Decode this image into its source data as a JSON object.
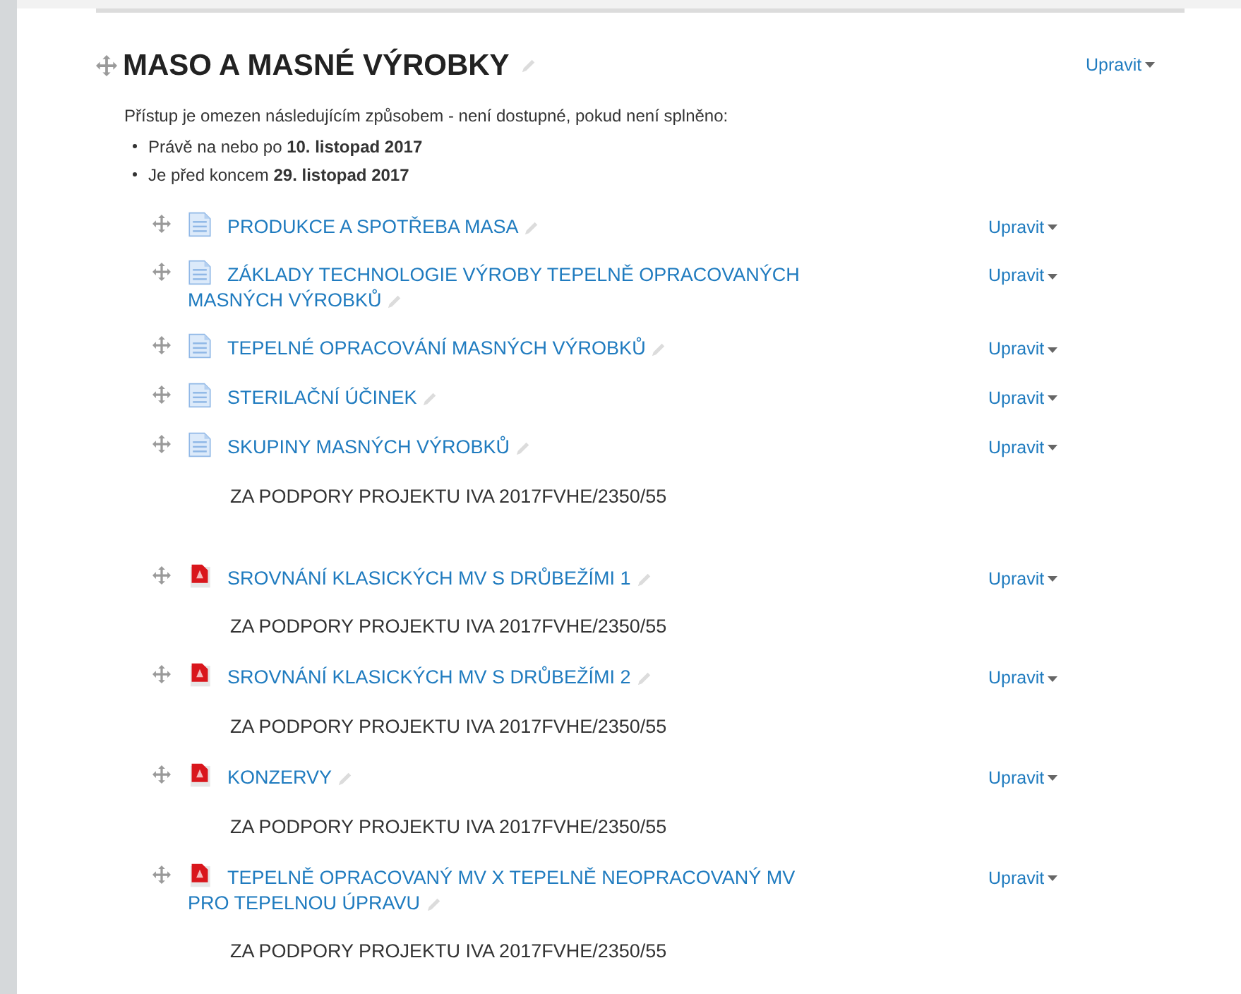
{
  "section": {
    "title": "MASO A MASNÉ VÝROBKY",
    "edit_menu": "Upravit",
    "restriction": {
      "intro": "Přístup je omezen následujícím způsobem - není dostupné, pokud není splněno:",
      "conditions": [
        "Právě na nebo po **10. listopad 2017**",
        "Je před koncem **29. listopad 2017**"
      ]
    }
  },
  "items": [
    {
      "kind": "page",
      "title": "PRODUKCE A SPOTŘEBA MASA",
      "edit_menu": "Upravit"
    },
    {
      "kind": "page",
      "title": "ZÁKLADY TECHNOLOGIE VÝROBY TEPELNĚ OPRACOVANÝCH MASNÝCH VÝROBKŮ",
      "edit_menu": "Upravit"
    },
    {
      "kind": "page",
      "title": "TEPELNÉ OPRACOVÁNÍ MASNÝCH VÝROBKŮ",
      "edit_menu": "Upravit"
    },
    {
      "kind": "page",
      "title": "STERILAČNÍ ÚČINEK",
      "edit_menu": "Upravit"
    },
    {
      "kind": "page",
      "title": "SKUPINY MASNÝCH VÝROBKŮ",
      "edit_menu": "Upravit",
      "description": "ZA PODPORY PROJEKTU IVA 2017FVHE/2350/55"
    },
    {
      "kind": "pdf",
      "title": "SROVNÁNÍ KLASICKÝCH MV S DRŮBEŽÍMI 1",
      "edit_menu": "Upravit",
      "description": "ZA PODPORY PROJEKTU IVA 2017FVHE/2350/55"
    },
    {
      "kind": "pdf",
      "title": "SROVNÁNÍ KLASICKÝCH MV S DRŮBEŽÍMI 2",
      "edit_menu": "Upravit",
      "description": "ZA PODPORY PROJEKTU IVA 2017FVHE/2350/55"
    },
    {
      "kind": "pdf",
      "title": "KONZERVY",
      "edit_menu": "Upravit",
      "description": "ZA PODPORY PROJEKTU IVA 2017FVHE/2350/55"
    },
    {
      "kind": "pdf",
      "title": "TEPELNĚ OPRACOVANÝ MV X TEPELNĚ NEOPRACOVANÝ MV PRO TEPELNOU ÚPRAVU",
      "edit_menu": "Upravit",
      "description": "ZA PODPORY PROJEKTU IVA 2017FVHE/2350/55"
    }
  ]
}
